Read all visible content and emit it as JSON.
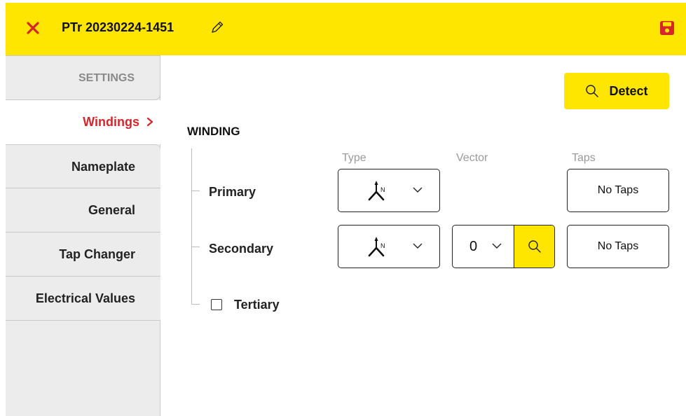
{
  "header": {
    "title": "PTr 20230224-1451",
    "close_icon": "close-icon",
    "edit_icon": "pencil-icon",
    "save_icon": "save-icon",
    "accent_color": "#ffe600",
    "alert_color": "#d6252b"
  },
  "sidebar": {
    "items": [
      {
        "label": "SETTINGS"
      },
      {
        "label": "Windings",
        "chevron": "›"
      },
      {
        "label": "Nameplate"
      },
      {
        "label": "General"
      },
      {
        "label": "Tap Changer"
      },
      {
        "label": "Electrical Values"
      }
    ]
  },
  "main": {
    "detect_label": "Detect",
    "section_title": "WINDING",
    "columns": {
      "type": "Type",
      "vector": "Vector",
      "taps": "Taps"
    },
    "rows": {
      "primary": {
        "label": "Primary",
        "type_icon": "wye-neutral-icon",
        "taps": "No Taps"
      },
      "secondary": {
        "label": "Secondary",
        "type_icon": "wye-neutral-icon",
        "vector": "0",
        "taps": "No Taps"
      },
      "tertiary": {
        "label": "Tertiary",
        "checked": false
      }
    }
  }
}
